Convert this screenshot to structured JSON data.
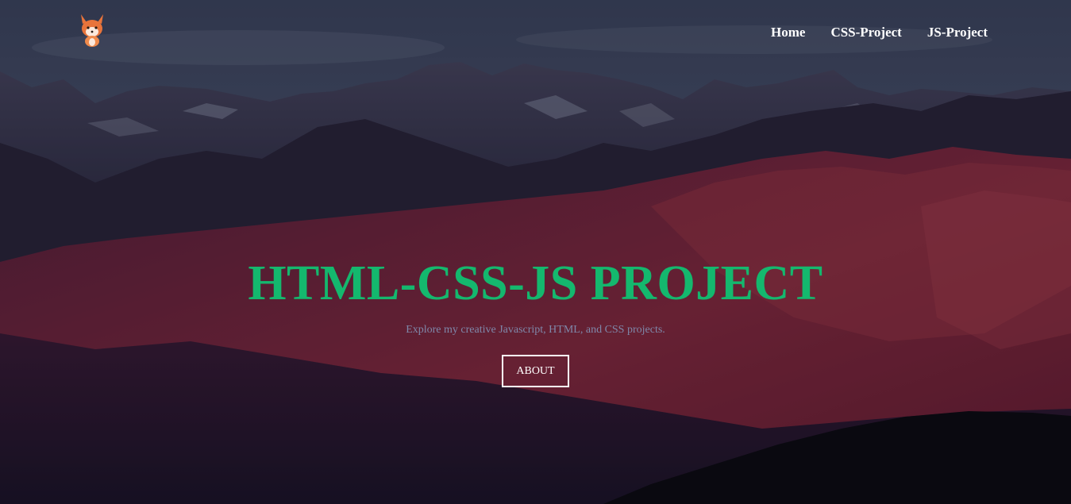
{
  "logo": {
    "icon": "fox-icon",
    "caption": ""
  },
  "nav": {
    "home_label": "Home",
    "css_label": "CSS-Project",
    "js_label": "JS-Project"
  },
  "hero": {
    "title": "HTML-CSS-JS PROJECT",
    "subtitle": "Explore my creative Javascript, HTML, and CSS projects.",
    "button_label": "ABOUT",
    "background": "mountain-landscape-image"
  },
  "colors": {
    "title": "#14b86e",
    "subtitle": "#7f88aa",
    "nav_text": "#ffffff",
    "button_border": "#ffffff"
  }
}
